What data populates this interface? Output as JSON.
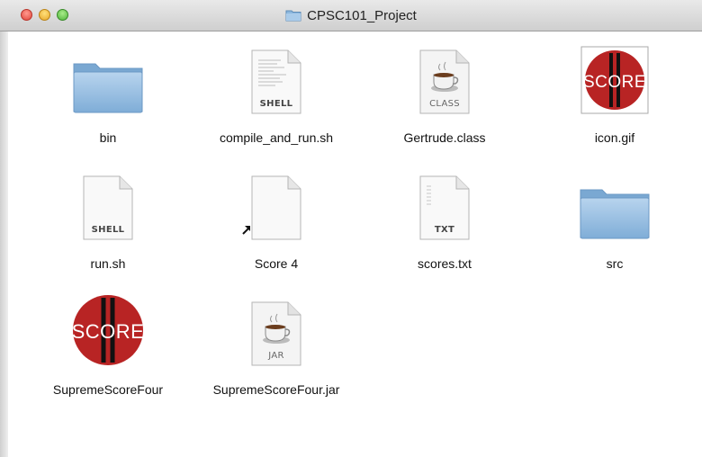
{
  "window": {
    "title": "CPSC101_Project"
  },
  "items": [
    {
      "label": "bin",
      "kind": "folder"
    },
    {
      "label": "compile_and_run.sh",
      "kind": "shell",
      "tag": "SHELL"
    },
    {
      "label": "Gertrude.class",
      "kind": "java",
      "tag": "CLASS"
    },
    {
      "label": "icon.gif",
      "kind": "score-image",
      "icon_text": "SCORE"
    },
    {
      "label": "run.sh",
      "kind": "shell",
      "tag": "SHELL"
    },
    {
      "label": "Score 4",
      "kind": "alias"
    },
    {
      "label": "scores.txt",
      "kind": "text",
      "tag": "TXT"
    },
    {
      "label": "src",
      "kind": "folder"
    },
    {
      "label": "SupremeScoreFour",
      "kind": "score-app",
      "icon_text": "SCORE"
    },
    {
      "label": "SupremeScoreFour.jar",
      "kind": "java",
      "tag": "JAR"
    }
  ],
  "colors": {
    "folder": "#8db8de",
    "score_red": "#b82424"
  }
}
